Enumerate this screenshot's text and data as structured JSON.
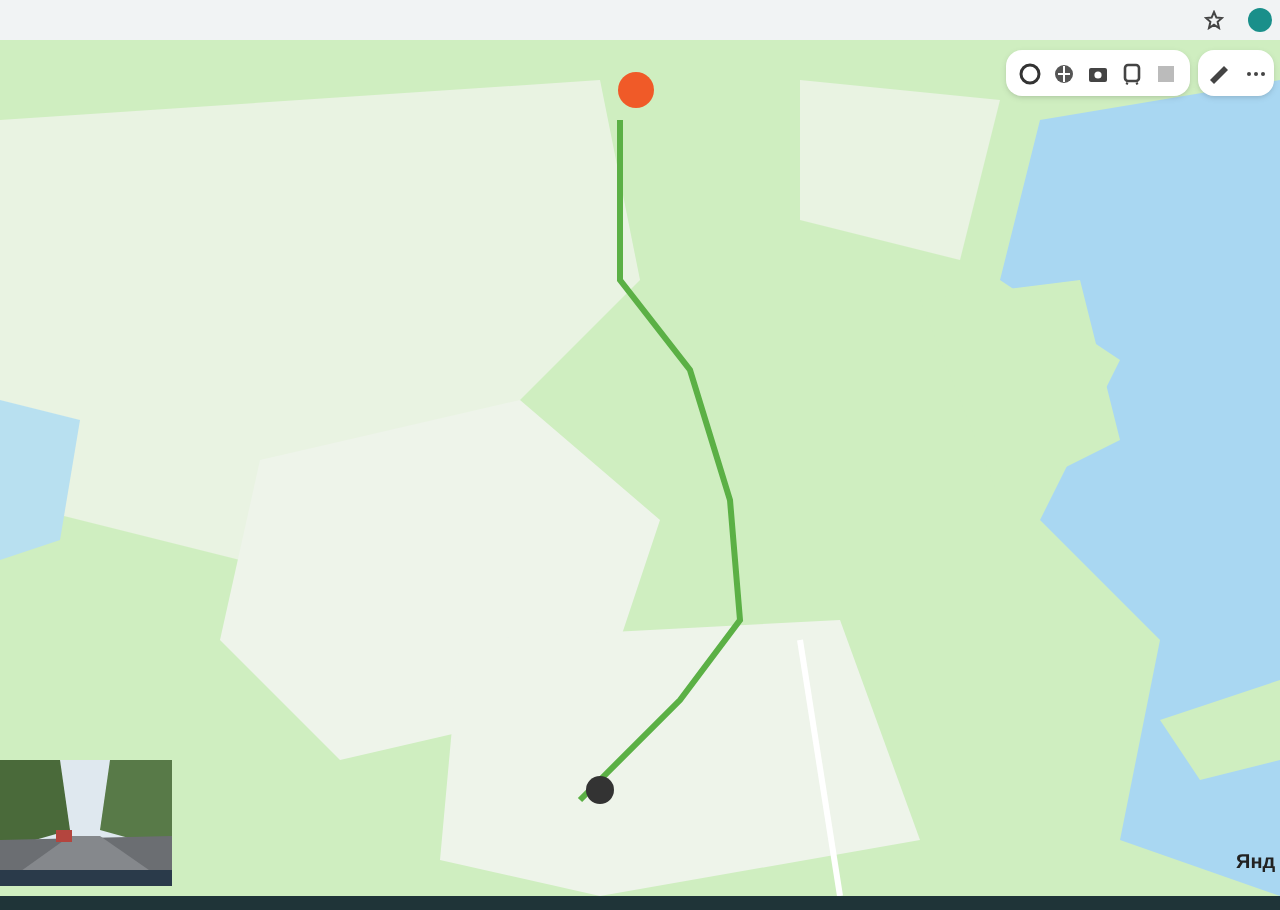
{
  "toolbar": [
    {
      "kind": "circle"
    },
    {
      "kind": "panorama"
    },
    {
      "kind": "camera"
    },
    {
      "kind": "transit"
    },
    {
      "kind": "square"
    }
  ],
  "tools": [
    {
      "kind": "ruler"
    },
    {
      "kind": "more"
    }
  ],
  "logo": "Янд"
}
